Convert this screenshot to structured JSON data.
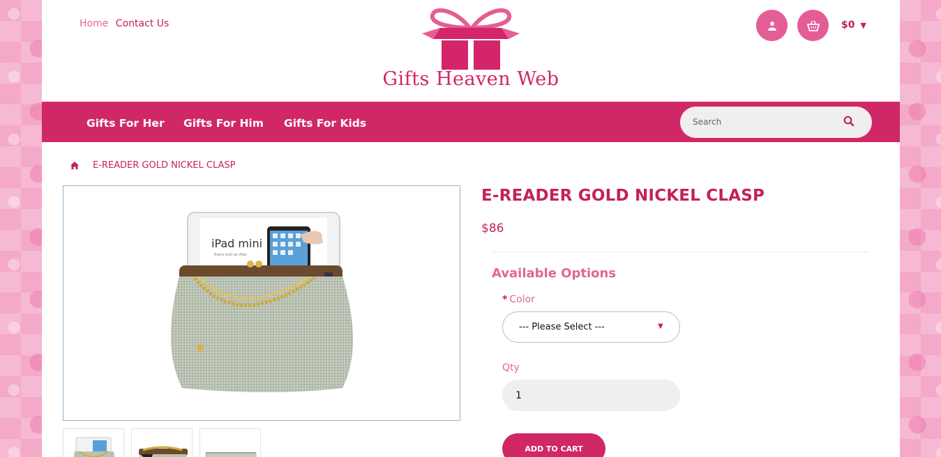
{
  "header": {
    "links": {
      "home": "Home",
      "contact": "Contact Us"
    },
    "logo_text": "Gifts Heaven Web",
    "cart_total": "$0"
  },
  "nav": {
    "items": [
      "Gifts For Her",
      "Gifts For Him",
      "Gifts For Kids"
    ],
    "search_placeholder": "Search"
  },
  "breadcrumb": {
    "current": "E-READER GOLD NICKEL CLASP"
  },
  "product": {
    "title": "E-READER GOLD NICKEL CLASP",
    "price": "$86",
    "image_caption": {
      "brand": "iPad mini",
      "tagline": "Every inch an iPad."
    },
    "options_heading": "Available Options",
    "color_label": "Color",
    "required_mark": "*",
    "color_selected": "--- Please Select ---",
    "qty_label": "Qty",
    "qty_value": "1",
    "add_to_cart": "ADD TO CART"
  },
  "colors": {
    "brand": "#d02866",
    "accent_pink": "#e55d95",
    "text_magenta": "#c4215a",
    "light_pink": "#e06597"
  },
  "icons": [
    "user-icon",
    "basket-icon",
    "chevron-down-icon",
    "search-icon",
    "home-icon"
  ]
}
